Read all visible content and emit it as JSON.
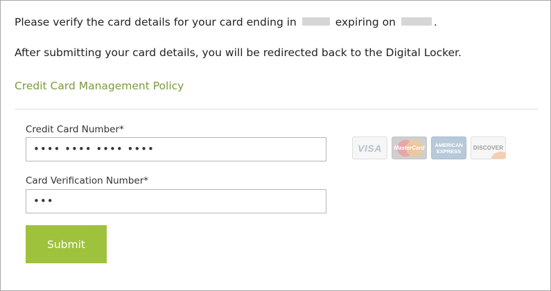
{
  "intro": {
    "verify_prefix": "Please verify the card details for your card ending in",
    "verify_middle": "expiring on",
    "verify_suffix": ".",
    "redirect_text": "After submitting your card details, you will be redirected back to the Digital Locker."
  },
  "policy_link": {
    "label": "Credit Card Management Policy",
    "color": "#7a9a3a"
  },
  "form": {
    "card_number": {
      "label": "Credit Card Number*",
      "value": "•••• •••• •••• ••••"
    },
    "cvv": {
      "label": "Card Verification Number*",
      "value": "•••"
    },
    "submit_label": "Submit",
    "submit_color": "#9ec23c"
  },
  "card_logos": [
    {
      "icon": "visa-logo-icon",
      "text": "VISA"
    },
    {
      "icon": "mastercard-logo-icon",
      "text": "MasterCard"
    },
    {
      "icon": "amex-logo-icon",
      "text": "AMERICAN EXPRESS"
    },
    {
      "icon": "discover-logo-icon",
      "text": "DISCOVER"
    }
  ]
}
